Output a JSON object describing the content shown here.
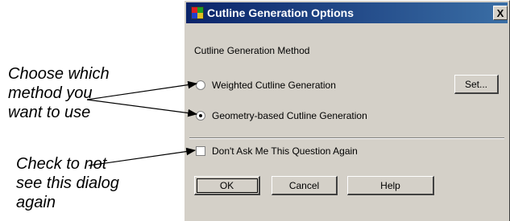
{
  "dialog": {
    "title": "Cutline Generation Options",
    "close_label": "X",
    "section_label": "Cutline Generation Method",
    "options": [
      {
        "label": "Weighted Cutline Generation",
        "selected": false
      },
      {
        "label": "Geometry-based Cutline Generation",
        "selected": true
      }
    ],
    "set_label": "Set...",
    "checkbox": {
      "label": "Don't Ask Me This Question Again",
      "checked": false
    },
    "buttons": {
      "ok": "OK",
      "cancel": "Cancel",
      "help": "Help"
    }
  },
  "annotations": {
    "callout_1": [
      "Choose which",
      "method you",
      "want to use"
    ],
    "callout_2": [
      "Check to not",
      "see this dialog",
      "again"
    ]
  },
  "colors": {
    "dialog_bg": "#d4d0c8",
    "titlebar_start": "#0a246a",
    "titlebar_end": "#3a6ea5"
  },
  "icons": {
    "app": "cutline-app-icon",
    "close": "close-icon"
  }
}
